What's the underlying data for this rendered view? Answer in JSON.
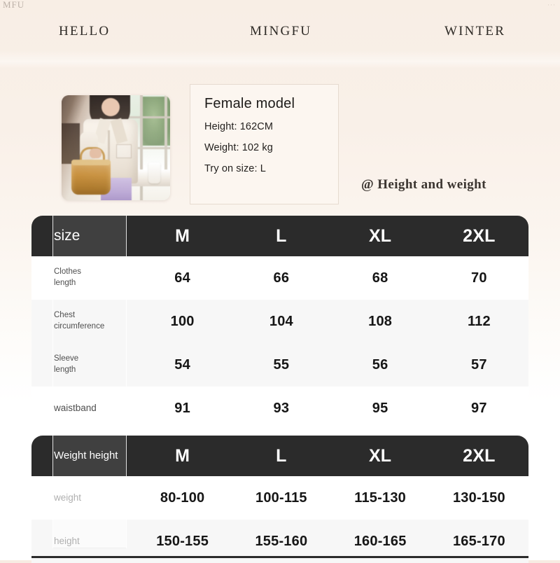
{
  "artifacts": {
    "top_left": "MFU",
    "top_right": "···"
  },
  "header": {
    "words": [
      {
        "text": "HELLO",
        "name": "brand-word-hello"
      },
      {
        "text": "MINGFU",
        "name": "brand-word-mingfu"
      },
      {
        "text": "WINTER",
        "name": "brand-word-winter"
      }
    ]
  },
  "model_card": {
    "title": "Female model",
    "height": "Height: 162CM",
    "weight": "Weight: 102 kg",
    "try_on": "Try on size: L"
  },
  "annotation": {
    "text": "@ Height and weight"
  },
  "photo": {
    "alt": "female model wearing cream pajama shirt holding woven basket bag by a window"
  },
  "colors": {
    "page_background": "#f8eee5",
    "header_dark": "#2b2b2b",
    "row_white": "#ffffff",
    "row_tint": "#f7f7f7",
    "text_dark": "#161616",
    "card_background": "#fcf6f0",
    "card_border": "#e6dbd0"
  },
  "size_table": {
    "header": {
      "label": "size",
      "sizes": [
        "M",
        "L",
        "XL",
        "2XL"
      ]
    },
    "rows": [
      {
        "label": "Clothes length",
        "label_lines": [
          "Clothes",
          "length"
        ],
        "values": [
          "64",
          "66",
          "68",
          "70"
        ]
      },
      {
        "label": "Chest circumference",
        "label_lines": [
          "Chest",
          "circumference"
        ],
        "values": [
          "100",
          "104",
          "108",
          "112"
        ]
      },
      {
        "label": "Sleeve length",
        "label_lines": [
          "Sleeve",
          "length"
        ],
        "values": [
          "54",
          "55",
          "56",
          "57"
        ]
      },
      {
        "label": "waistband",
        "label_lines": [
          "waistband"
        ],
        "values": [
          "91",
          "93",
          "95",
          "97"
        ]
      }
    ]
  },
  "weight_height_table": {
    "header": {
      "label": "Weight height",
      "sizes": [
        "M",
        "L",
        "XL",
        "2XL"
      ]
    },
    "rows": [
      {
        "label": "weight",
        "label_lines": [
          "weight"
        ],
        "values": [
          "80-100",
          "100-115",
          "115-130",
          "130-150"
        ]
      },
      {
        "label": "height",
        "label_lines": [
          "height"
        ],
        "values": [
          "150-155",
          "155-160",
          "160-165",
          "165-170"
        ]
      }
    ]
  }
}
